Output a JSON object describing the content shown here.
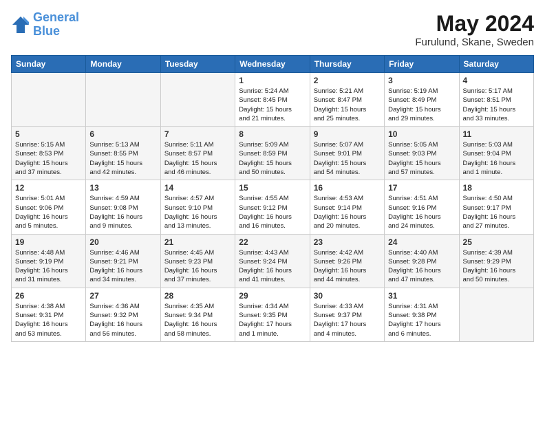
{
  "header": {
    "logo_line1": "General",
    "logo_line2": "Blue",
    "month": "May 2024",
    "location": "Furulund, Skane, Sweden"
  },
  "weekdays": [
    "Sunday",
    "Monday",
    "Tuesday",
    "Wednesday",
    "Thursday",
    "Friday",
    "Saturday"
  ],
  "weeks": [
    [
      {
        "day": "",
        "info": ""
      },
      {
        "day": "",
        "info": ""
      },
      {
        "day": "",
        "info": ""
      },
      {
        "day": "1",
        "info": "Sunrise: 5:24 AM\nSunset: 8:45 PM\nDaylight: 15 hours\nand 21 minutes."
      },
      {
        "day": "2",
        "info": "Sunrise: 5:21 AM\nSunset: 8:47 PM\nDaylight: 15 hours\nand 25 minutes."
      },
      {
        "day": "3",
        "info": "Sunrise: 5:19 AM\nSunset: 8:49 PM\nDaylight: 15 hours\nand 29 minutes."
      },
      {
        "day": "4",
        "info": "Sunrise: 5:17 AM\nSunset: 8:51 PM\nDaylight: 15 hours\nand 33 minutes."
      }
    ],
    [
      {
        "day": "5",
        "info": "Sunrise: 5:15 AM\nSunset: 8:53 PM\nDaylight: 15 hours\nand 37 minutes."
      },
      {
        "day": "6",
        "info": "Sunrise: 5:13 AM\nSunset: 8:55 PM\nDaylight: 15 hours\nand 42 minutes."
      },
      {
        "day": "7",
        "info": "Sunrise: 5:11 AM\nSunset: 8:57 PM\nDaylight: 15 hours\nand 46 minutes."
      },
      {
        "day": "8",
        "info": "Sunrise: 5:09 AM\nSunset: 8:59 PM\nDaylight: 15 hours\nand 50 minutes."
      },
      {
        "day": "9",
        "info": "Sunrise: 5:07 AM\nSunset: 9:01 PM\nDaylight: 15 hours\nand 54 minutes."
      },
      {
        "day": "10",
        "info": "Sunrise: 5:05 AM\nSunset: 9:03 PM\nDaylight: 15 hours\nand 57 minutes."
      },
      {
        "day": "11",
        "info": "Sunrise: 5:03 AM\nSunset: 9:04 PM\nDaylight: 16 hours\nand 1 minute."
      }
    ],
    [
      {
        "day": "12",
        "info": "Sunrise: 5:01 AM\nSunset: 9:06 PM\nDaylight: 16 hours\nand 5 minutes."
      },
      {
        "day": "13",
        "info": "Sunrise: 4:59 AM\nSunset: 9:08 PM\nDaylight: 16 hours\nand 9 minutes."
      },
      {
        "day": "14",
        "info": "Sunrise: 4:57 AM\nSunset: 9:10 PM\nDaylight: 16 hours\nand 13 minutes."
      },
      {
        "day": "15",
        "info": "Sunrise: 4:55 AM\nSunset: 9:12 PM\nDaylight: 16 hours\nand 16 minutes."
      },
      {
        "day": "16",
        "info": "Sunrise: 4:53 AM\nSunset: 9:14 PM\nDaylight: 16 hours\nand 20 minutes."
      },
      {
        "day": "17",
        "info": "Sunrise: 4:51 AM\nSunset: 9:16 PM\nDaylight: 16 hours\nand 24 minutes."
      },
      {
        "day": "18",
        "info": "Sunrise: 4:50 AM\nSunset: 9:17 PM\nDaylight: 16 hours\nand 27 minutes."
      }
    ],
    [
      {
        "day": "19",
        "info": "Sunrise: 4:48 AM\nSunset: 9:19 PM\nDaylight: 16 hours\nand 31 minutes."
      },
      {
        "day": "20",
        "info": "Sunrise: 4:46 AM\nSunset: 9:21 PM\nDaylight: 16 hours\nand 34 minutes."
      },
      {
        "day": "21",
        "info": "Sunrise: 4:45 AM\nSunset: 9:23 PM\nDaylight: 16 hours\nand 37 minutes."
      },
      {
        "day": "22",
        "info": "Sunrise: 4:43 AM\nSunset: 9:24 PM\nDaylight: 16 hours\nand 41 minutes."
      },
      {
        "day": "23",
        "info": "Sunrise: 4:42 AM\nSunset: 9:26 PM\nDaylight: 16 hours\nand 44 minutes."
      },
      {
        "day": "24",
        "info": "Sunrise: 4:40 AM\nSunset: 9:28 PM\nDaylight: 16 hours\nand 47 minutes."
      },
      {
        "day": "25",
        "info": "Sunrise: 4:39 AM\nSunset: 9:29 PM\nDaylight: 16 hours\nand 50 minutes."
      }
    ],
    [
      {
        "day": "26",
        "info": "Sunrise: 4:38 AM\nSunset: 9:31 PM\nDaylight: 16 hours\nand 53 minutes."
      },
      {
        "day": "27",
        "info": "Sunrise: 4:36 AM\nSunset: 9:32 PM\nDaylight: 16 hours\nand 56 minutes."
      },
      {
        "day": "28",
        "info": "Sunrise: 4:35 AM\nSunset: 9:34 PM\nDaylight: 16 hours\nand 58 minutes."
      },
      {
        "day": "29",
        "info": "Sunrise: 4:34 AM\nSunset: 9:35 PM\nDaylight: 17 hours\nand 1 minute."
      },
      {
        "day": "30",
        "info": "Sunrise: 4:33 AM\nSunset: 9:37 PM\nDaylight: 17 hours\nand 4 minutes."
      },
      {
        "day": "31",
        "info": "Sunrise: 4:31 AM\nSunset: 9:38 PM\nDaylight: 17 hours\nand 6 minutes."
      },
      {
        "day": "",
        "info": ""
      }
    ]
  ]
}
